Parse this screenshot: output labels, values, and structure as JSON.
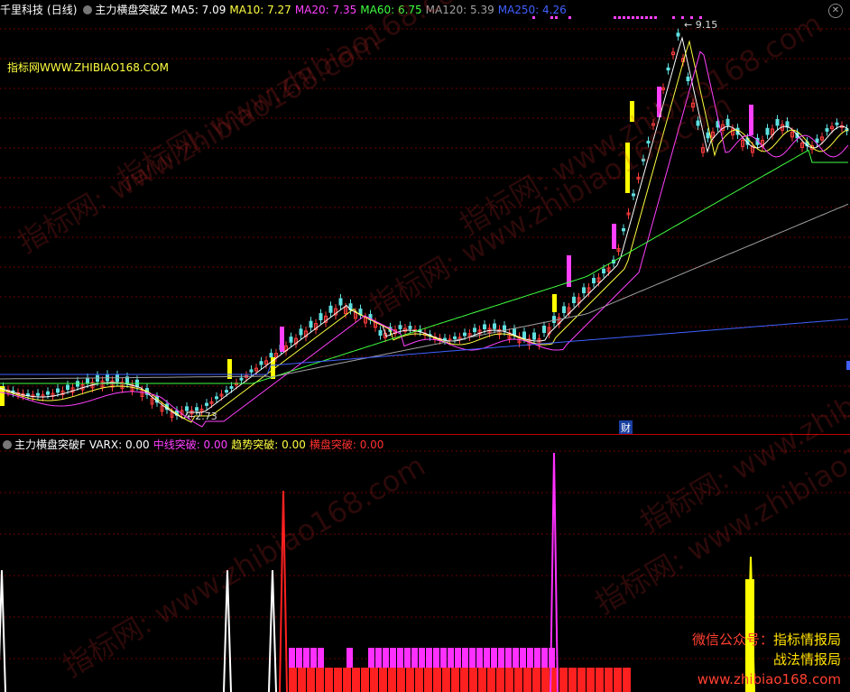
{
  "main": {
    "stock_name": "千里科技",
    "period": "(日线)",
    "indicator_name": "主力横盘突破Z",
    "ma": [
      {
        "label": "MA5: 7.09",
        "color": "#ffffff"
      },
      {
        "label": "MA10: 7.27",
        "color": "#ffff40"
      },
      {
        "label": "MA20: 7.35",
        "color": "#ff40ff"
      },
      {
        "label": "MA60: 6.75",
        "color": "#40ff40"
      },
      {
        "label": "MA120: 5.39",
        "color": "#a0a0a0"
      },
      {
        "label": "MA250: 4.26",
        "color": "#4060ff"
      }
    ],
    "high_label": "9.15",
    "low_label": "2.73",
    "site_label": "指标网WWW.ZHIBIAO168.COM",
    "fin_badge": "财",
    "close_icon": "close-icon"
  },
  "sub": {
    "indicator_name": "主力横盘突破F",
    "values": [
      {
        "label": "VARX: 0.00",
        "color": "#ffffff"
      },
      {
        "label": "中线突破: 0.00",
        "color": "#ff40ff"
      },
      {
        "label": "趋势突破: 0.00",
        "color": "#ffff40"
      },
      {
        "label": "横盘突破: 0.00",
        "color": "#ff3030"
      }
    ]
  },
  "watermark": "指标网: www.zhibiao168.com",
  "promo": {
    "line1_a": "微信公众号：",
    "line1_b": "指标情报局",
    "line2": "战法情报局",
    "line3": "www.zhibiao168.com"
  },
  "chart_data": {
    "type": "candlestick",
    "price_range": [
      2.73,
      9.15
    ],
    "ma_colors": {
      "ma5": "#ffffff",
      "ma10": "#ffff40",
      "ma20": "#ff40ff",
      "ma60": "#40ff40",
      "ma120": "#a0a0a0",
      "ma250": "#4060ff"
    }
  }
}
